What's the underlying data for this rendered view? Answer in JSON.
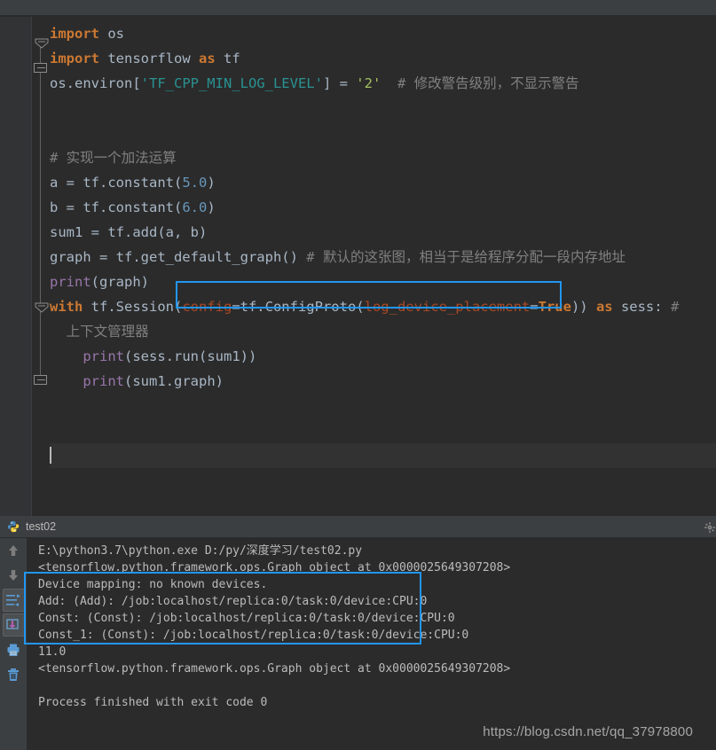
{
  "window": {
    "background_color": "#2b2b2b",
    "panel_color": "#3c3f41",
    "accent_annotation_color": "#2196f3"
  },
  "editor": {
    "lines": [
      {
        "id": "line-import-os",
        "segments": [
          {
            "t": "import",
            "c": "kw"
          },
          {
            "t": " os",
            "c": "id"
          }
        ]
      },
      {
        "id": "line-import-tf",
        "segments": [
          {
            "t": "import",
            "c": "kw"
          },
          {
            "t": " tensorflow ",
            "c": "id"
          },
          {
            "t": "as",
            "c": "kw"
          },
          {
            "t": " tf",
            "c": "id"
          }
        ]
      },
      {
        "id": "line-environ",
        "segments": [
          {
            "t": "os.environ[",
            "c": "id"
          },
          {
            "t": "'TF_CPP_MIN_LOG_LEVEL'",
            "c": "teal"
          },
          {
            "t": "] = ",
            "c": "id"
          },
          {
            "t": "'2'",
            "c": "strg"
          },
          {
            "t": "  # 修改警告级别，不显示警告",
            "c": "cmt"
          }
        ]
      },
      {
        "id": "line-blank-1",
        "segments": []
      },
      {
        "id": "line-blank-2",
        "segments": []
      },
      {
        "id": "line-comment-add",
        "segments": [
          {
            "t": "# 实现一个加法运算",
            "c": "cmt"
          }
        ]
      },
      {
        "id": "line-a-const",
        "segments": [
          {
            "t": "a = tf.constant(",
            "c": "id"
          },
          {
            "t": "5.0",
            "c": "num"
          },
          {
            "t": ")",
            "c": "id"
          }
        ]
      },
      {
        "id": "line-b-const",
        "segments": [
          {
            "t": "b = tf.constant(",
            "c": "id"
          },
          {
            "t": "6.0",
            "c": "num"
          },
          {
            "t": ")",
            "c": "id"
          }
        ]
      },
      {
        "id": "line-sum1",
        "segments": [
          {
            "t": "sum1 = tf.add(a, b)",
            "c": "id"
          }
        ]
      },
      {
        "id": "line-graph",
        "segments": [
          {
            "t": "graph = tf.get_default_graph()",
            "c": "id"
          },
          {
            "t": " # 默认的这张图，相当于是给程序分配一段内存地址",
            "c": "cmt"
          }
        ]
      },
      {
        "id": "line-print-graph",
        "segments": [
          {
            "t": "print",
            "c": "blu"
          },
          {
            "t": "(graph)",
            "c": "id"
          }
        ]
      },
      {
        "id": "line-with-session",
        "segments": [
          {
            "t": "with",
            "c": "kw"
          },
          {
            "t": " tf.Session(",
            "c": "id"
          },
          {
            "t": "config",
            "c": "param"
          },
          {
            "t": "=tf.ConfigProto(",
            "c": "id"
          },
          {
            "t": "log_device_placement",
            "c": "param"
          },
          {
            "t": "=",
            "c": "id"
          },
          {
            "t": "True",
            "c": "kw"
          },
          {
            "t": ")) ",
            "c": "id"
          },
          {
            "t": "as",
            "c": "kw"
          },
          {
            "t": " sess: ",
            "c": "id"
          },
          {
            "t": "#",
            "c": "cmt"
          }
        ]
      },
      {
        "id": "line-wrapped-comment",
        "segments": [
          {
            "t": "  上下文管理器",
            "c": "cmt"
          }
        ]
      },
      {
        "id": "line-print-run",
        "segments": [
          {
            "t": "    ",
            "c": "id"
          },
          {
            "t": "print",
            "c": "blu"
          },
          {
            "t": "(sess.run(sum1))",
            "c": "id"
          }
        ]
      },
      {
        "id": "line-print-sumgraph",
        "segments": [
          {
            "t": "    ",
            "c": "id"
          },
          {
            "t": "print",
            "c": "blu"
          },
          {
            "t": "(sum1.graph)",
            "c": "id"
          }
        ]
      }
    ],
    "caret_line_index": 17
  },
  "console": {
    "tab_label": "test02",
    "toolbar_buttons": [
      {
        "name": "scroll-up-button",
        "icon": "arrow-up-icon"
      },
      {
        "name": "scroll-down-button",
        "icon": "arrow-down-icon"
      },
      {
        "name": "soft-wrap-button",
        "icon": "soft-wrap-icon"
      },
      {
        "name": "scroll-to-end-button",
        "icon": "scroll-to-end-icon"
      },
      {
        "name": "print-button",
        "icon": "printer-icon"
      },
      {
        "name": "clear-all-button",
        "icon": "trash-icon"
      }
    ],
    "settings_icon": "gear-icon",
    "output_lines": [
      "E:\\python3.7\\python.exe D:/py/深度学习/test02.py",
      "<tensorflow.python.framework.ops.Graph object at 0x0000025649307208>",
      "Device mapping: no known devices.",
      "Add: (Add): /job:localhost/replica:0/task:0/device:CPU:0",
      "Const: (Const): /job:localhost/replica:0/task:0/device:CPU:0",
      "Const_1: (Const): /job:localhost/replica:0/task:0/device:CPU:0",
      "11.0",
      "<tensorflow.python.framework.ops.Graph object at 0x0000025649307208>",
      "",
      "Process finished with exit code 0"
    ]
  },
  "annotations": [
    {
      "name": "annotation-box-session-config",
      "target": "config=tf.ConfigProto(log_device_placement=True)"
    },
    {
      "name": "annotation-box-device-mapping",
      "target": "Device mapping output lines"
    }
  ],
  "watermark": {
    "text": "https://blog.csdn.net/qq_37978800"
  }
}
